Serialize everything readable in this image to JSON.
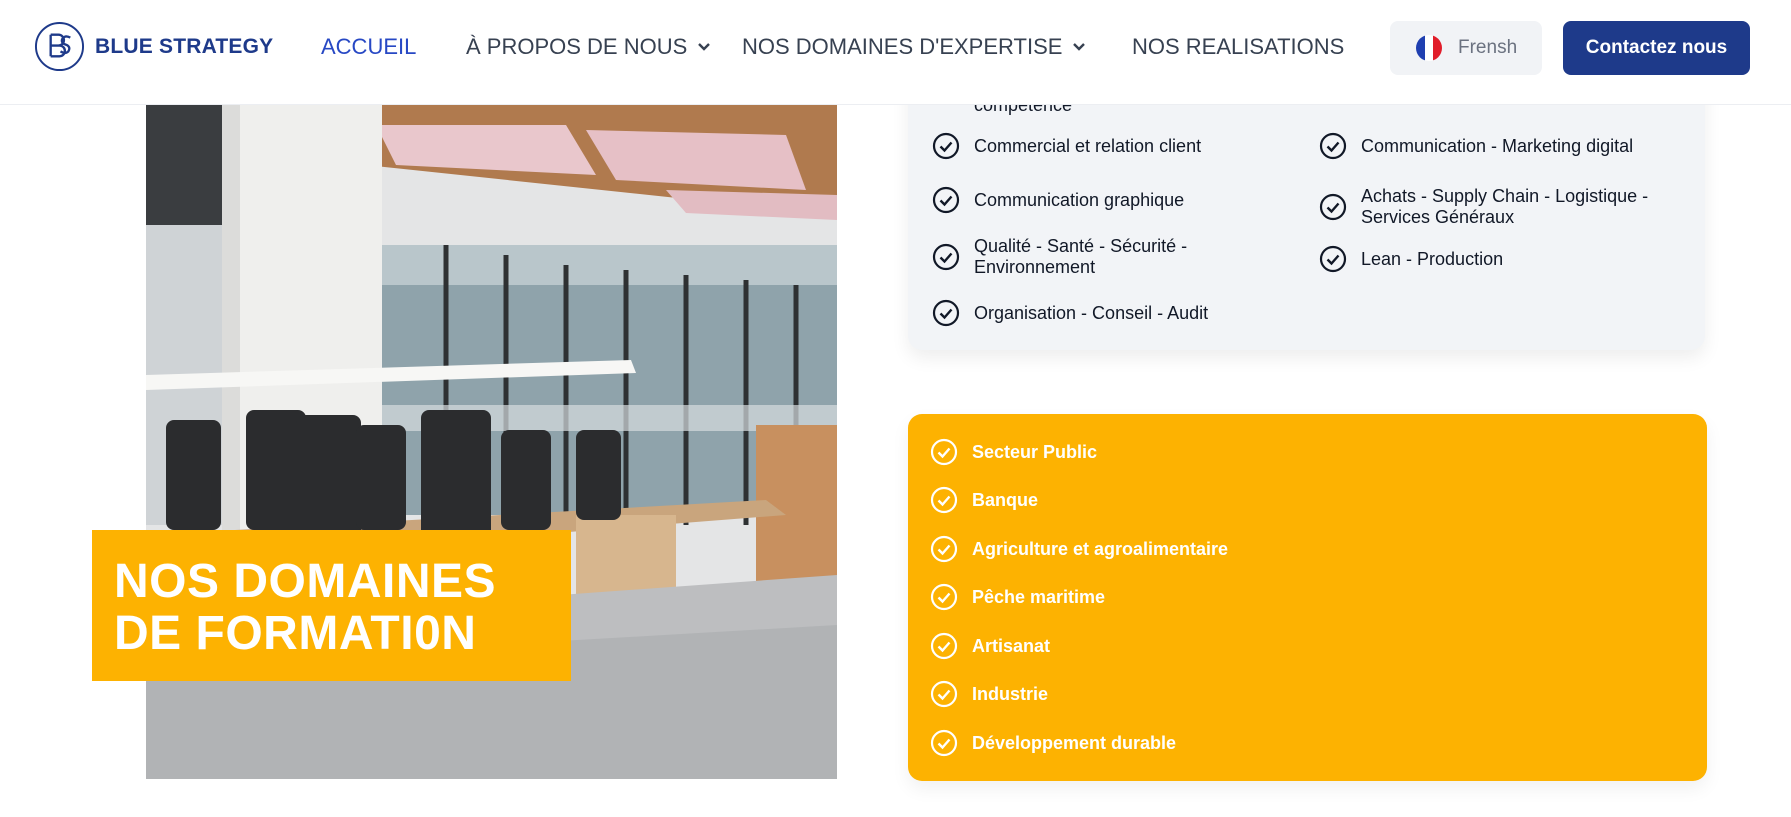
{
  "header": {
    "brand": "BLUE STRATEGY",
    "logo_icon": "bs-monogram-logo",
    "nav": [
      {
        "label": "ACCUEIL",
        "active": true
      },
      {
        "label": "À PROPOS DE NOUS",
        "dropdown": true
      },
      {
        "label": "NOS DOMAINES D'EXPERTISE",
        "dropdown": true
      },
      {
        "label": "NOS REALISATIONS"
      }
    ],
    "language": {
      "label": "Frensh",
      "flag_icon": "france-flag-icon"
    },
    "contact_label": "Contactez nous"
  },
  "hero": {
    "title_line1": "NOS DOMAINES",
    "title_line2": "DE FORMATI0N",
    "photo": "office-room-photo"
  },
  "domains_list": {
    "partial_top": "compétence",
    "left": [
      "Commercial et relation client",
      "Communication graphique",
      "Qualité - Santé - Sécurité - Environnement",
      "Organisation - Conseil - Audit"
    ],
    "right": [
      "Communication - Marketing digital",
      "Achats - Supply Chain - Logistique - Services Généraux",
      "Lean - Production"
    ]
  },
  "sectors_list": [
    "Secteur Public",
    "Banque",
    "Agriculture et agroalimentaire",
    "Pêche maritime",
    "Artisanat",
    "Industrie",
    "Développement durable"
  ],
  "colors": {
    "primary": "#1e3a8a",
    "nav_active": "#2748c4",
    "accent_yellow": "#fdb201",
    "card_grey": "#f2f4f7"
  }
}
